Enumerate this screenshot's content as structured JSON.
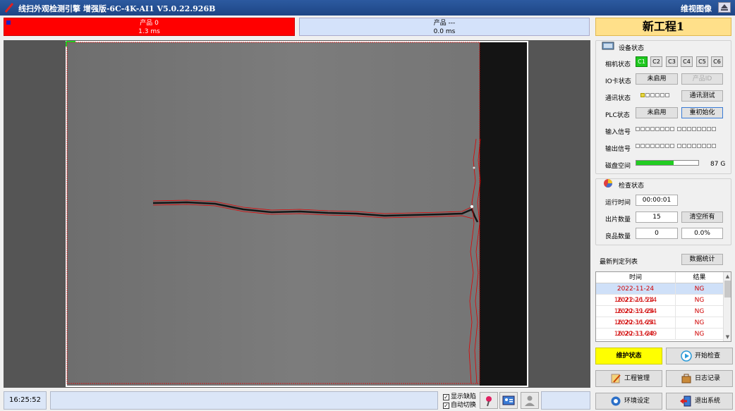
{
  "window": {
    "title": "线扫外观检测引擎 增强版-6C-4K-AI1 V5.0.22.926B",
    "right_title": "维视图像"
  },
  "products": [
    {
      "name": "产品 0",
      "time": "1.3 ms"
    },
    {
      "name": "产品 ---",
      "time": "0.0 ms"
    }
  ],
  "project_name": "新工程1",
  "device_status": {
    "title": "设备状态",
    "camera_label": "相机状态",
    "cameras": [
      "C1",
      "C2",
      "C3",
      "C4",
      "C5",
      "C6"
    ],
    "io_label": "IO卡状态",
    "io_button": "未启用",
    "io_product_button": "产品ID",
    "comm_label": "通讯状态",
    "comm_test_button": "通讯测试",
    "plc_label": "PLC状态",
    "plc_button": "未启用",
    "plc_reinit_button": "重初始化",
    "input_label": "输入信号",
    "output_label": "输出信号",
    "disk_label": "磁盘空间",
    "disk_value": "87 G",
    "disk_fill": 0.6
  },
  "inspection_status": {
    "title": "检查状态",
    "runtime_label": "运行时间",
    "runtime_value": "00:00:01",
    "count_label": "出片数量",
    "count_value": "15",
    "clear_button": "清空所有",
    "good_label": "良品数量",
    "good_value": "0",
    "good_rate": "0.0%"
  },
  "recent_list": {
    "title": "最新判定列表",
    "stats_button": "数据统计",
    "columns": [
      "时间",
      "结果"
    ],
    "rows": [
      {
        "time": "2022-11-24 16:21:26.514",
        "result": "NG"
      },
      {
        "time": "2022-11-24 16:20:39.654",
        "result": "NG"
      },
      {
        "time": "2022-11-24 16:20:36.651",
        "result": "NG"
      },
      {
        "time": "2022-11-24 16:20:33.649",
        "result": "NG"
      },
      {
        "time": "2022-11-24 16:20:30.648",
        "result": "NG"
      }
    ]
  },
  "actions": {
    "maintenance": "维护状态",
    "start_check": "开始检查",
    "project_manage": "工程管理",
    "log_record": "日志记录",
    "env_settings": "环境设定",
    "exit_system": "退出系统"
  },
  "statusbar": {
    "clock": "16:25:52",
    "show_defects": "显示缺陷",
    "auto_switch": "自动切换"
  },
  "colors": {
    "ng_text": "#d00000",
    "active_camera": "#1fc81f",
    "product_active": "#ff0000",
    "maintenance_bg": "#ffff00"
  }
}
